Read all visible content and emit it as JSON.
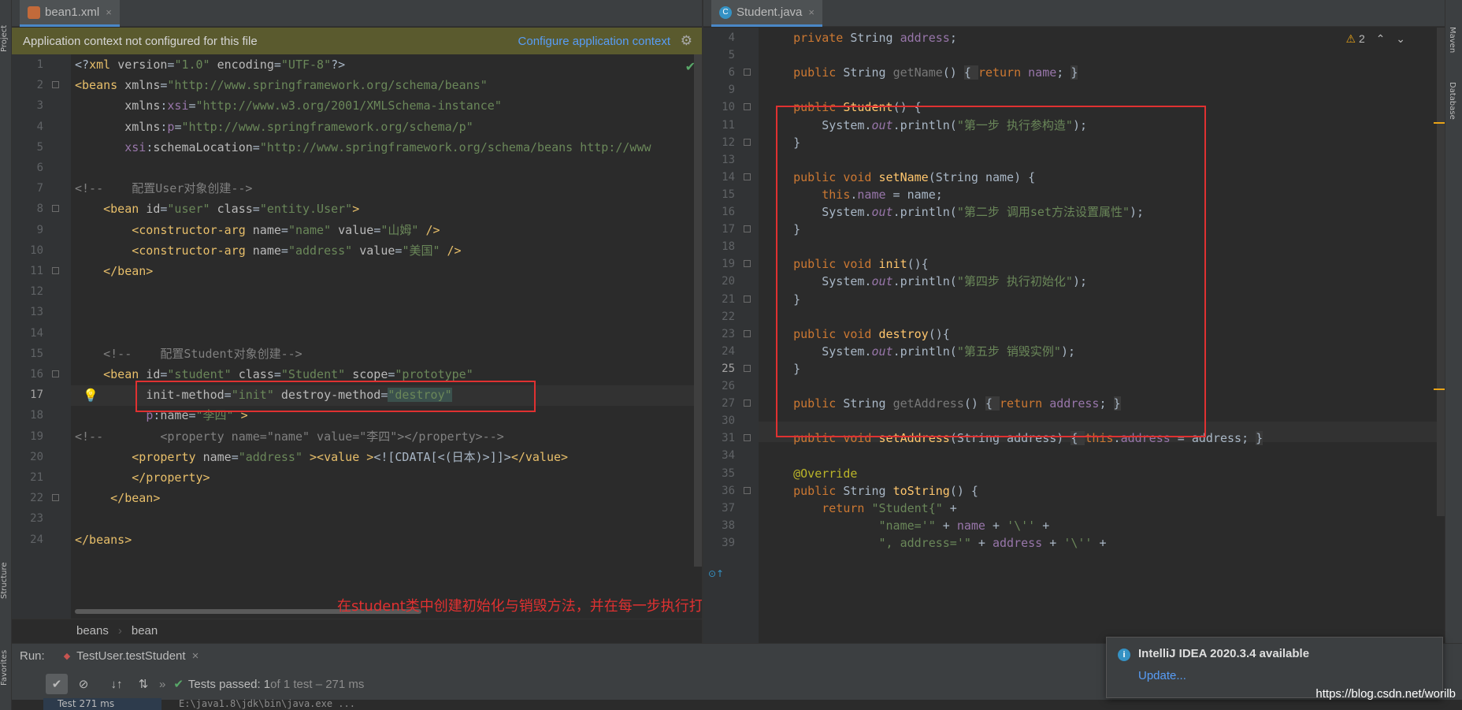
{
  "left_strip": {
    "project": "Project",
    "structure": "Structure",
    "favorites": "Favorites"
  },
  "right_strip": {
    "maven": "Maven",
    "database": "Database"
  },
  "left_tab": {
    "label": "bean1.xml",
    "close": "×"
  },
  "right_tab": {
    "label": "Student.java",
    "close": "×"
  },
  "banner": {
    "message": "Application context not configured for this file",
    "link": "Configure application context"
  },
  "warnings": {
    "count": "2"
  },
  "xml_lines": [
    {
      "n": "1",
      "html": "<span class='pl'>&lt;?</span><span class='tg'>xml</span> <span class='at'>version</span>=<span class='s'>\"1.0\"</span> <span class='at'>encoding</span>=<span class='s'>\"UTF-8\"</span><span class='pl'>?&gt;</span>"
    },
    {
      "n": "2",
      "html": "<span class='tg'>&lt;beans</span> <span class='at'>xmlns</span>=<span class='s'>\"http://www.springframework.org/schema/beans\"</span>"
    },
    {
      "n": "3",
      "html": "       <span class='at'>xmlns</span>:<span class='ns'>xsi</span>=<span class='s'>\"http://www.w3.org/2001/XMLSchema-instance\"</span>"
    },
    {
      "n": "4",
      "html": "       <span class='at'>xmlns</span>:<span class='ns'>p</span>=<span class='s'>\"http://www.springframework.org/schema/p\"</span>"
    },
    {
      "n": "5",
      "html": "       <span class='ns'>xsi</span>:<span class='at'>schemaLocation</span>=<span class='s'>\"http://www.springframework.org/schema/beans http://www</span>"
    },
    {
      "n": "6",
      "html": ""
    },
    {
      "n": "7",
      "html": "<span class='c'>&lt;!--    配置User对象创建--&gt;</span>"
    },
    {
      "n": "8",
      "html": "    <span class='tg'>&lt;bean</span> <span class='at'>id</span>=<span class='s'>\"user\"</span> <span class='at'>class</span>=<span class='s'>\"entity.User\"</span><span class='tg'>&gt;</span>"
    },
    {
      "n": "9",
      "html": "        <span class='tg'>&lt;constructor-arg</span> <span class='at'>name</span>=<span class='s'>\"name\"</span> <span class='at'>value</span>=<span class='s'>\"山姆\"</span> <span class='tg'>/&gt;</span>"
    },
    {
      "n": "10",
      "html": "        <span class='tg'>&lt;constructor-arg</span> <span class='at'>name</span>=<span class='s'>\"address\"</span> <span class='at'>value</span>=<span class='s'>\"美国\"</span> <span class='tg'>/&gt;</span>"
    },
    {
      "n": "11",
      "html": "    <span class='tg'>&lt;/bean&gt;</span>"
    },
    {
      "n": "12",
      "html": ""
    },
    {
      "n": "13",
      "html": ""
    },
    {
      "n": "14",
      "html": ""
    },
    {
      "n": "15",
      "html": "    <span class='c'>&lt;!--    配置Student对象创建--&gt;</span>"
    },
    {
      "n": "16",
      "html": "    <span class='tg'>&lt;bean</span> <span class='at'>id</span>=<span class='s'>\"student\"</span> <span class='at'>class</span>=<span class='s'>\"Student\"</span> <span class='at'>scope</span>=<span class='s'>\"prototype\"</span>"
    },
    {
      "n": "17",
      "html": "          <span class='at'>init-method</span>=<span class='s'>\"init\"</span> <span class='at'>destroy-method</span>=<span class='s' style='background:#3b514d'>\"destroy\"</span>"
    },
    {
      "n": "18",
      "html": "          <span class='ns'>p</span>:<span class='at'>name</span>=<span class='s'>\"李四\"</span> <span class='tg'>&gt;</span>"
    },
    {
      "n": "19",
      "html": "<span class='c'>&lt;!--        &lt;property name=\"name\" value=\"李四\"&gt;&lt;/property&gt;--&gt;</span>"
    },
    {
      "n": "20",
      "html": "        <span class='tg'>&lt;property</span> <span class='at'>name</span>=<span class='s'>\"address\"</span> <span class='tg'>&gt;&lt;value</span> <span class='tg'>&gt;</span><span class='pl'>&lt;![CDATA[&lt;(日本)&gt;]]&gt;</span><span class='tg'>&lt;/value&gt;</span>"
    },
    {
      "n": "21",
      "html": "        <span class='tg'>&lt;/property&gt;</span>"
    },
    {
      "n": "22",
      "html": "     <span class='tg'>&lt;/bean&gt;</span>"
    },
    {
      "n": "23",
      "html": ""
    },
    {
      "n": "24",
      "html": "<span class='tg'>&lt;/beans&gt;</span>"
    }
  ],
  "java_lines": [
    {
      "n": "4",
      "html": "    <span class='k'>private</span> String <span class='fld'>address</span>;"
    },
    {
      "n": "5",
      "html": ""
    },
    {
      "n": "6",
      "html": "    <span class='k'>public</span> String <span class='ph'>getName</span>() <span style='background:#3a3a3a'>{ </span><span class='k'>return</span> <span class='fld'>name</span>; <span style='background:#3a3a3a'>}</span>"
    },
    {
      "n": "9",
      "html": ""
    },
    {
      "n": "10",
      "html": "    <span class='k'>public</span> <span class='f'>Student</span>() {"
    },
    {
      "n": "11",
      "html": "        System.<span class='i'>out</span>.println(<span class='s'>\"第一步 执行参构造\"</span>);"
    },
    {
      "n": "12",
      "html": "    }"
    },
    {
      "n": "13",
      "html": ""
    },
    {
      "n": "14",
      "html": "    <span class='k'>public void</span> <span class='f'>setName</span>(String name) {"
    },
    {
      "n": "15",
      "html": "        <span class='k'>this</span>.<span class='fld'>name</span> = name;"
    },
    {
      "n": "16",
      "html": "        System.<span class='i'>out</span>.println(<span class='s'>\"第二步 调用set方法设置属性\"</span>);"
    },
    {
      "n": "17",
      "html": "    }"
    },
    {
      "n": "18",
      "html": ""
    },
    {
      "n": "19",
      "html": "    <span class='k'>public void</span> <span class='f'>init</span>(){"
    },
    {
      "n": "20",
      "html": "        System.<span class='i'>out</span>.println(<span class='s'>\"第四步 执行初始化\"</span>);"
    },
    {
      "n": "21",
      "html": "    }"
    },
    {
      "n": "22",
      "html": ""
    },
    {
      "n": "23",
      "html": "    <span class='k'>public void</span> <span class='f'>destroy</span>(){"
    },
    {
      "n": "24",
      "html": "        System.<span class='i'>out</span>.println(<span class='s'>\"第五步 销毁实例\"</span>);"
    },
    {
      "n": "25",
      "html": "    }"
    },
    {
      "n": "26",
      "html": ""
    },
    {
      "n": "27",
      "html": "    <span class='k'>public</span> String <span class='ph'>getAddress</span>() <span style='background:#3a3a3a'>{ </span><span class='k'>return</span> <span class='fld'>address</span>; <span style='background:#3a3a3a'>}</span>"
    },
    {
      "n": "30",
      "html": ""
    },
    {
      "n": "31",
      "html": "    <span class='k'>public void</span> <span class='f'>setAddress</span>(String address) <span style='background:#3a3a3a'>{ </span><span class='k'>this</span>.<span class='fld'>address</span> = address; <span style='background:#3a3a3a'>}</span>"
    },
    {
      "n": "34",
      "html": ""
    },
    {
      "n": "35",
      "html": "    <span class='an'>@Override</span>"
    },
    {
      "n": "36",
      "html": "    <span class='k'>public</span> String <span class='f'>toString</span>() {"
    },
    {
      "n": "37",
      "html": "        <span class='k'>return</span> <span class='s'>\"Student{\"</span> +"
    },
    {
      "n": "38",
      "html": "                <span class='s'>\"name='\"</span> + <span class='fld'>name</span> + <span class='s'>'\\''</span> +"
    },
    {
      "n": "39",
      "html": "                <span class='s'>\", address='\"</span> + <span class='fld'>address</span> + <span class='s'>'\\''</span> +"
    }
  ],
  "breadcrumb": [
    "beans",
    "bean"
  ],
  "annotation": "在student类中创建初始化与销毁方法，并在每一步执行打印语句",
  "run": {
    "label": "Run:",
    "config": "TestUser.testStudent",
    "status_bold": "Tests passed: 1",
    "status_rest": " of 1 test – 271 ms",
    "tree_item": "Test  271 ms",
    "console": "E:\\java1.8\\jdk\\bin\\java.exe ..."
  },
  "notification": {
    "title": "IntelliJ IDEA 2020.3.4 available",
    "link": "Update..."
  },
  "watermark": "https://blog.csdn.net/worilb"
}
